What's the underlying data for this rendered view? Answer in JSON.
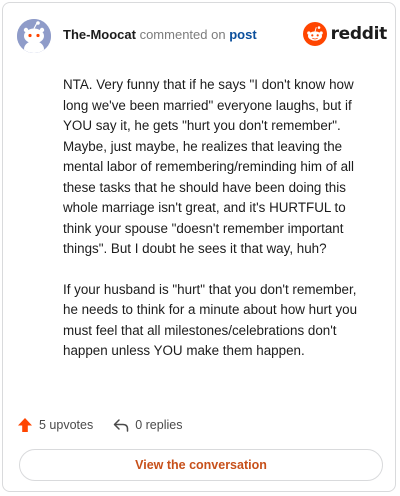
{
  "header": {
    "author": "The-Moocat",
    "action": "commented on",
    "post_link": "post",
    "brand": "reddit"
  },
  "comment": {
    "paragraphs": [
      "NTA. Very funny that if he says \"I don't know how long we've been married\" everyone laughs, but if YOU say it, he gets \"hurt you don't remember\". Maybe, just maybe, he realizes that leaving the mental labor of remembering/reminding him of all these tasks that he should have been doing this whole marriage isn't great, and it's HURTFUL to think your spouse \"doesn't remember important things\". But I doubt he sees it that way, huh?",
      "If your husband is \"hurt\" that you don't remember, he needs to think for a minute about how hurt you must feel that all milestones/celebrations don't happen unless YOU make them happen."
    ]
  },
  "footer": {
    "upvotes": "5 upvotes",
    "replies": "0 replies",
    "view_conversation": "View the conversation"
  },
  "colors": {
    "accent": "#ff4500",
    "link": "#0b4f9c",
    "button_text": "#c7501a",
    "avatar": "#8f9cc9"
  },
  "icons": {
    "avatar": "snoo-avatar-icon",
    "logo": "reddit-logo-icon",
    "upvote": "upvote-arrow-icon",
    "reply": "reply-arrow-icon"
  }
}
